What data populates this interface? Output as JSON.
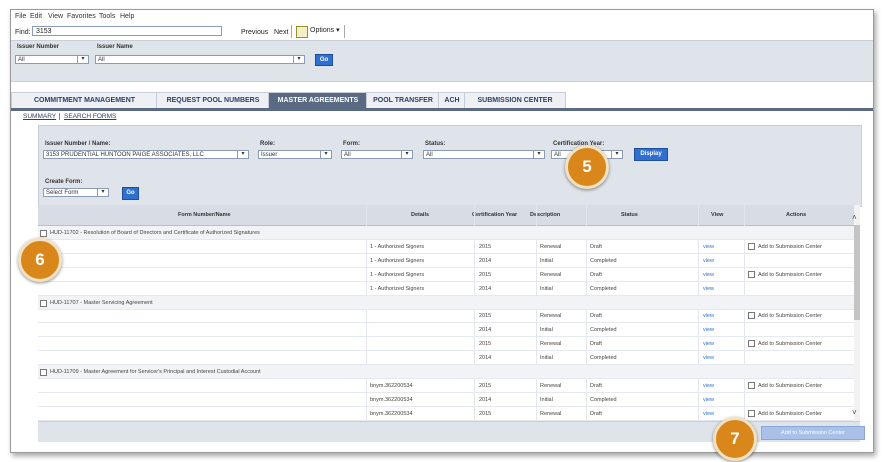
{
  "menu": [
    "File",
    "Edit",
    "View",
    "Favorites",
    "Tools",
    "Help"
  ],
  "findbar": {
    "label": "Find:",
    "value": "3153",
    "previous": "Previous",
    "next": "Next",
    "options": "Options ▾"
  },
  "filter": {
    "issuer_number_label": "Issuer Number",
    "issuer_name_label": "Issuer Name",
    "issuer_number_value": "All",
    "issuer_name_value": "All",
    "go": "Go"
  },
  "tabs": [
    "COMMITMENT MANAGEMENT",
    "REQUEST POOL NUMBERS",
    "MASTER AGREEMENTS",
    "POOL TRANSFER",
    "ACH",
    "SUBMISSION CENTER"
  ],
  "active_tab": "MASTER AGREEMENTS",
  "subtabs": [
    "SUMMARY",
    "SEARCH FORMS"
  ],
  "form": {
    "issuer_label": "Issuer Number / Name:",
    "issuer_value": "3153 PRUDENTIAL HUNTOON PAIGE ASSOCIATES, LLC",
    "role_label": "Role:",
    "role_value": "Issuer",
    "form_label": "Form:",
    "form_value": "All",
    "status_label": "Status:",
    "status_value": "All",
    "cert_year_label": "Certification Year:",
    "cert_year_value": "All",
    "display": "Display",
    "create_form_label": "Create Form:",
    "create_form_value": "Select Form",
    "go": "Go"
  },
  "grid": {
    "headers": [
      "Form Number/Name",
      "Details",
      "Certification Year",
      "Description",
      "Status",
      "View",
      "Actions"
    ],
    "rows": [
      {
        "group": "HUD-11702 - Resolution of Board of Directors and Certificate of Authorized Signatures"
      },
      {
        "details": "1 - Authorized Signers",
        "year": "2015",
        "desc": "Renewal",
        "status": "Draft",
        "view": "view",
        "action": "Add to Submission Center"
      },
      {
        "details": "1 - Authorized Signers",
        "year": "2014",
        "desc": "Initial",
        "status": "Completed",
        "view": "view",
        "action": ""
      },
      {
        "details": "1 - Authorized Signers",
        "year": "2015",
        "desc": "Renewal",
        "status": "Draft",
        "view": "view",
        "action": "Add to Submission Center"
      },
      {
        "details": "1 - Authorized Signers",
        "year": "2014",
        "desc": "Initial",
        "status": "Completed",
        "view": "view",
        "action": ""
      },
      {
        "group": "HUD-11707 - Master Servicing Agreement"
      },
      {
        "details": "",
        "year": "2015",
        "desc": "Renewal",
        "status": "Draft",
        "view": "view",
        "action": "Add to Submission Center"
      },
      {
        "details": "",
        "year": "2014",
        "desc": "Initial",
        "status": "Completed",
        "view": "view",
        "action": ""
      },
      {
        "details": "",
        "year": "2015",
        "desc": "Renewal",
        "status": "Draft",
        "view": "view",
        "action": "Add to Submission Center"
      },
      {
        "details": "",
        "year": "2014",
        "desc": "Initial",
        "status": "Completed",
        "view": "view",
        "action": ""
      },
      {
        "group": "HUD-11709 - Master Agreement for Servicer's Principal and Interest Custodial Account"
      },
      {
        "details": "bnym.362200534",
        "year": "2015",
        "desc": "Renewal",
        "status": "Draft",
        "view": "view",
        "action": "Add to Submission Center"
      },
      {
        "details": "bnym.362200534",
        "year": "2014",
        "desc": "Initial",
        "status": "Completed",
        "view": "view",
        "action": ""
      },
      {
        "details": "bnym.362200534",
        "year": "2015",
        "desc": "Renewal",
        "status": "Draft",
        "view": "view",
        "action": "Add to Submission Center"
      }
    ]
  },
  "footer_button": "Add to Submission Center",
  "callouts": [
    "5",
    "6",
    "7"
  ],
  "colors": {
    "accent_blue": "#2f6fd1",
    "active_tab": "#5a6a82",
    "callout": "#d9861b"
  }
}
